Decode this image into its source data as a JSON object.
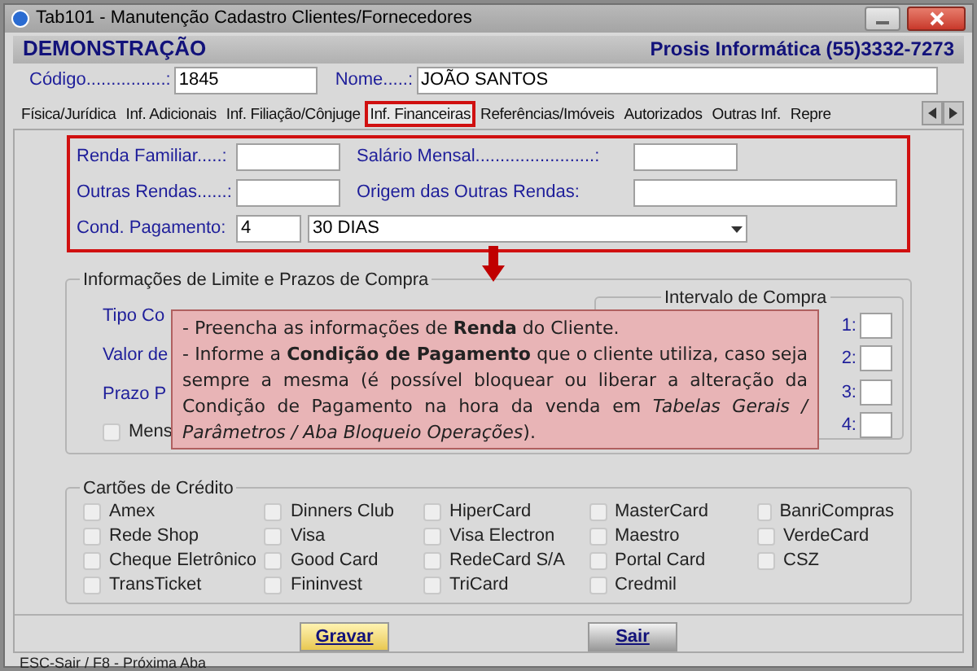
{
  "window": {
    "title": "Tab101 - Manutenção Cadastro Clientes/Fornecedores"
  },
  "header": {
    "company": "DEMONSTRAÇÃO",
    "vendor": "Prosis Informática (55)3332-7273"
  },
  "record": {
    "code_label": "Código................:",
    "code": "1845",
    "name_label": "Nome.....:",
    "name": "JOÃO SANTOS"
  },
  "tabs": [
    {
      "label": "Física/Jurídica",
      "selected": false
    },
    {
      "label": "Inf. Adicionais",
      "selected": false
    },
    {
      "label": "Inf. Filiação/Cônjuge",
      "selected": false
    },
    {
      "label": "Inf. Financeiras",
      "selected": true
    },
    {
      "label": "Referências/Imóveis",
      "selected": false
    },
    {
      "label": "Autorizados",
      "selected": false
    },
    {
      "label": "Outras Inf.",
      "selected": false
    },
    {
      "label": "Repre",
      "selected": false
    }
  ],
  "income": {
    "family_label": "Renda Familiar.....:",
    "salary_label": "Salário Mensal........................:",
    "other_label": "Outras Rendas......:",
    "origin_label": "Origem das Outras Rendas:",
    "payment_label": "Cond. Pagamento:",
    "payment_code": "4",
    "payment_name": "30 DIAS"
  },
  "limits": {
    "title": "Informações de Limite e Prazos de Compra",
    "labels": [
      "Tipo Co",
      "Valor de",
      "Prazo P"
    ],
    "monthly": {
      "label": "Mens",
      "checked": false
    },
    "interval_title": "Intervalo de Compra",
    "interval_labels": [
      "1:",
      "2:",
      "3:",
      "4:"
    ]
  },
  "callout": [
    "- Preencha as informações de **Renda** do Cliente.",
    "- Informe a **Condição de Pagamento** que o cliente utiliza, caso seja sempre a mesma (é possível bloquear ou liberar a alteração da Condição de Pagamento na hora da venda em *Tabelas Gerais / Parâmetros / Aba Bloqueio Operações*)."
  ],
  "cards": {
    "title": "Cartões de Crédito",
    "columns": [
      [
        {
          "label": "Amex",
          "checked": false
        },
        {
          "label": "Rede Shop",
          "checked": false
        },
        {
          "label": "Cheque Eletrônico",
          "checked": false
        },
        {
          "label": "TransTicket",
          "checked": false
        }
      ],
      [
        {
          "label": "Dinners Club",
          "checked": false
        },
        {
          "label": "Visa",
          "checked": false
        },
        {
          "label": "Good Card",
          "checked": false
        },
        {
          "label": "Fininvest",
          "checked": false
        }
      ],
      [
        {
          "label": "HiperCard",
          "checked": false
        },
        {
          "label": "Visa Electron",
          "checked": false
        },
        {
          "label": "RedeCard S/A",
          "checked": false
        },
        {
          "label": "TriCard",
          "checked": false
        }
      ],
      [
        {
          "label": "MasterCard",
          "checked": false
        },
        {
          "label": "Maestro",
          "checked": false
        },
        {
          "label": "Portal Card",
          "checked": false
        },
        {
          "label": "Credmil",
          "checked": false
        }
      ],
      [
        {
          "label": "BanriCompras",
          "checked": false
        },
        {
          "label": "VerdeCard",
          "checked": false
        },
        {
          "label": "CSZ",
          "checked": false
        }
      ]
    ]
  },
  "buttons": [
    {
      "label": "Gravar",
      "kind": "primary"
    },
    {
      "label": "Sair",
      "kind": "secondary"
    }
  ],
  "status_bar": "ESC-Sair / F8 - Próxima Aba"
}
